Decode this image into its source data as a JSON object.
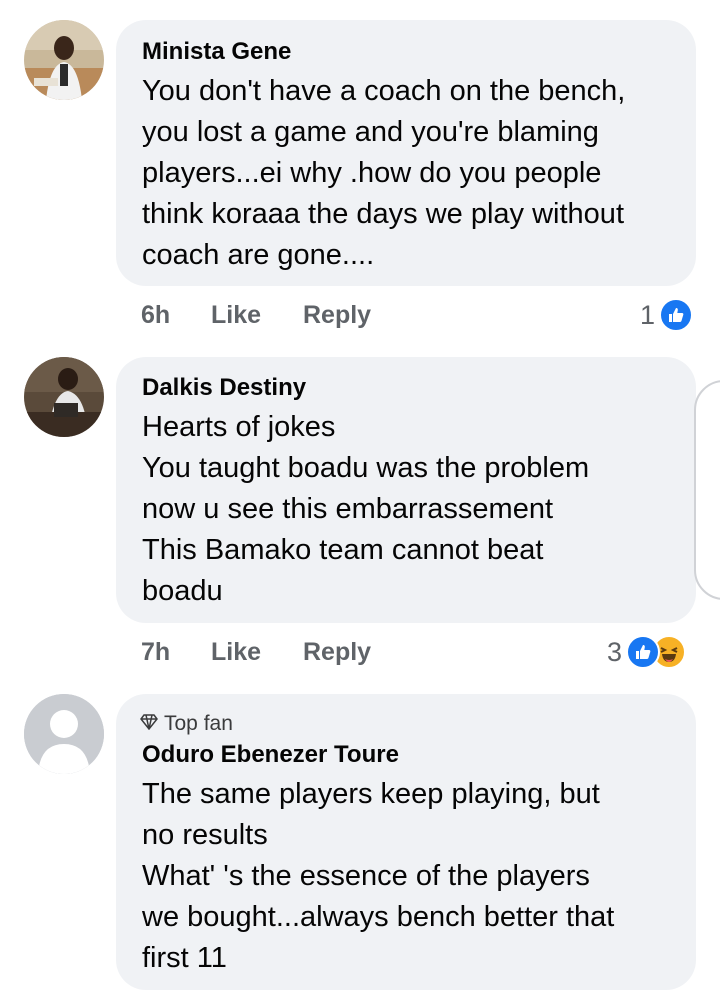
{
  "comments": [
    {
      "author": "Minista Gene",
      "lines": [
        "You don't have a coach on the bench,",
        "you lost a game and you're blaming",
        "players...ei why .how do you people",
        "think koraaa the days we play without",
        "coach are gone...."
      ],
      "time": "6h",
      "like_label": "Like",
      "reply_label": "Reply",
      "reaction_count": "1",
      "reactions": [
        "like-icon"
      ]
    },
    {
      "author": "Dalkis Destiny",
      "lines": [
        "Hearts of jokes",
        "You taught boadu was the problem",
        "now u see this embarrassement",
        "This Bamako team cannot beat",
        "boadu"
      ],
      "time": "7h",
      "like_label": "Like",
      "reply_label": "Reply",
      "reaction_count": "3",
      "reactions": [
        "like-icon",
        "haha-icon"
      ]
    },
    {
      "badge": "Top fan",
      "author": "Oduro Ebenezer Toure",
      "lines": [
        "The same players keep playing, but",
        "no results",
        "What' 's the essence of the players",
        "we bought...always bench better that",
        "first 11"
      ]
    }
  ],
  "colors": {
    "bubble": "#f0f2f5",
    "meta": "#5f6368",
    "like_blue": "#1877f2",
    "haha_yellow": "#f7b125"
  }
}
